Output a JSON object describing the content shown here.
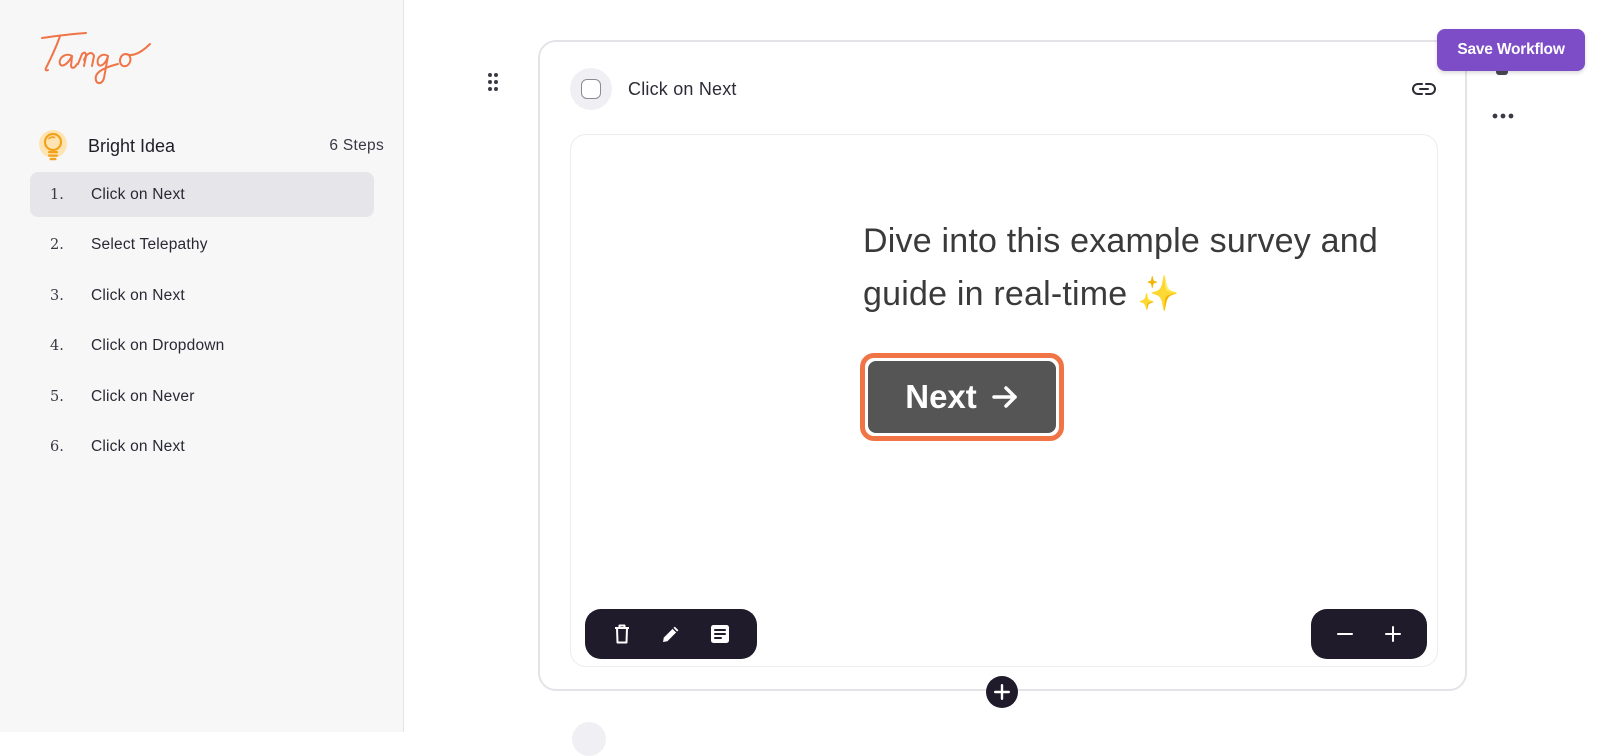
{
  "app": {
    "logo_text": "Tango",
    "accent_color": "#f07446",
    "primary_button_color": "#7d4cc7"
  },
  "sidebar": {
    "workflow": {
      "icon": "lightbulb-icon",
      "title": "Bright Idea",
      "step_count": "6 Steps"
    },
    "steps": [
      {
        "number": "1.",
        "label": "Click on Next",
        "active": true
      },
      {
        "number": "2.",
        "label": "Select Telepathy",
        "active": false
      },
      {
        "number": "3.",
        "label": "Click on Next",
        "active": false
      },
      {
        "number": "4.",
        "label": "Click on Dropdown",
        "active": false
      },
      {
        "number": "5.",
        "label": "Click on Never",
        "active": false
      },
      {
        "number": "6.",
        "label": "Click on Next",
        "active": false
      }
    ]
  },
  "header": {
    "save_label": "Save Workflow",
    "more_icon": "more-horizontal-icon"
  },
  "step_card": {
    "title": "Click on Next",
    "link_icon": "link-icon",
    "screenshot": {
      "line1": "Dive into this example survey and",
      "line2": "guide in real-time ✨",
      "button_label": "Next"
    },
    "tools_left": [
      "trash-icon",
      "pencil-icon",
      "note-icon"
    ],
    "tools_right": [
      "zoom-out-icon",
      "zoom-in-icon"
    ],
    "add_step_icon": "plus-circle-icon"
  }
}
